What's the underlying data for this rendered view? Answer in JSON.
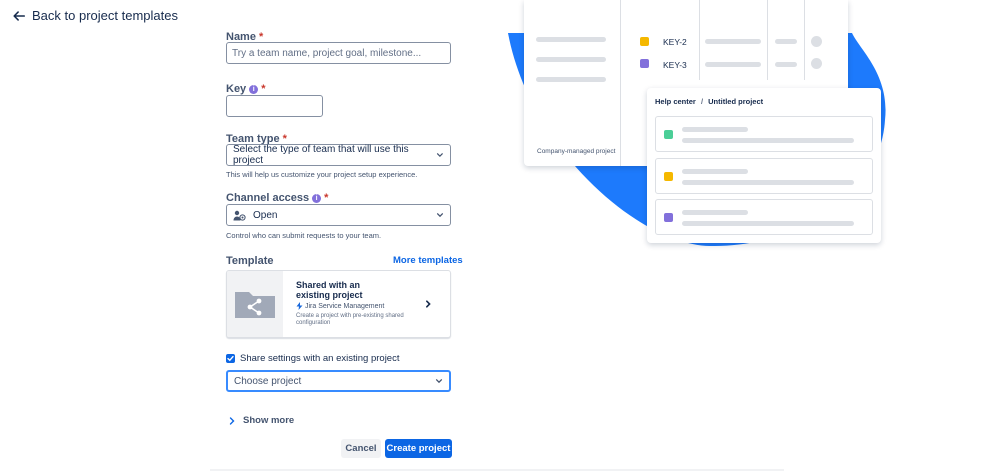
{
  "nav": {
    "back_label": "Back to project templates"
  },
  "form": {
    "name": {
      "label": "Name",
      "placeholder": "Try a team name, project goal, milestone..."
    },
    "key": {
      "label": "Key",
      "value": ""
    },
    "team_type": {
      "label": "Team type",
      "value": "Select the type of team that will use this project",
      "help": "This will help us customize your project setup experience."
    },
    "channel_access": {
      "label": "Channel access",
      "value": "Open",
      "help": "Control who can submit requests to your team."
    },
    "template": {
      "label": "Template",
      "more_link": "More templates",
      "title": "Shared with an existing project",
      "product": "Jira Service Management",
      "description": "Create a project with pre-existing shared configuration"
    },
    "share_settings": {
      "label": "Share settings with an existing project",
      "checked": true
    },
    "choose_project": {
      "value": "Choose project"
    },
    "show_more": "Show more",
    "cancel_label": "Cancel",
    "create_label": "Create project",
    "required_mark": "*"
  },
  "illustration": {
    "keys": [
      "KEY-2",
      "KEY-3"
    ],
    "project_type_label": "Company-managed project",
    "breadcrumb_root": "Help center",
    "breadcrumb_sep": "/",
    "breadcrumb_current": "Untitled project",
    "colors": {
      "blob": "#1d7afc",
      "yellow": "#f5b800",
      "purple": "#8270db",
      "green": "#4bce97"
    }
  },
  "colors": {
    "primary": "#0c66e4",
    "text": "#172b4d",
    "subtle": "#44546f",
    "required": "#c9372c"
  }
}
